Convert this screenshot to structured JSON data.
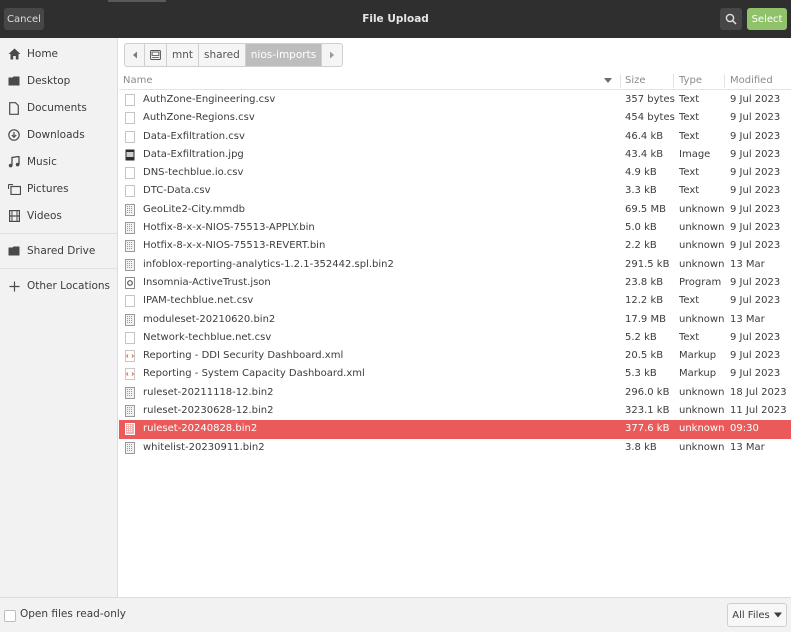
{
  "header": {
    "cancel_label": "Cancel",
    "title": "File Upload",
    "select_label": "Select"
  },
  "sidebar": {
    "items": [
      {
        "label": "Home",
        "icon": "home-icon"
      },
      {
        "label": "Desktop",
        "icon": "desktop-icon"
      },
      {
        "label": "Documents",
        "icon": "documents-icon"
      },
      {
        "label": "Downloads",
        "icon": "downloads-icon"
      },
      {
        "label": "Music",
        "icon": "music-icon"
      },
      {
        "label": "Pictures",
        "icon": "pictures-icon"
      },
      {
        "label": "Videos",
        "icon": "videos-icon"
      },
      {
        "label": "Shared Drive",
        "icon": "drive-icon"
      },
      {
        "label": "Other Locations",
        "icon": "plus-icon"
      }
    ]
  },
  "pathbar": {
    "segments": [
      "mnt",
      "shared",
      "nios-imports"
    ]
  },
  "columns": {
    "name": "Name",
    "size": "Size",
    "type": "Type",
    "modified": "Modified"
  },
  "files": [
    {
      "name": "AuthZone-Engineering.csv",
      "size": "357 bytes",
      "type": "Text",
      "modified": "9 Jul 2023",
      "icon": "text-file-icon"
    },
    {
      "name": "AuthZone-Regions.csv",
      "size": "454 bytes",
      "type": "Text",
      "modified": "9 Jul 2023",
      "icon": "text-file-icon"
    },
    {
      "name": "Data-Exfiltration.csv",
      "size": "46.4 kB",
      "type": "Text",
      "modified": "9 Jul 2023",
      "icon": "text-file-icon"
    },
    {
      "name": "Data-Exfiltration.jpg",
      "size": "43.4 kB",
      "type": "Image",
      "modified": "9 Jul 2023",
      "icon": "image-file-icon"
    },
    {
      "name": "DNS-techblue.io.csv",
      "size": "4.9 kB",
      "type": "Text",
      "modified": "9 Jul 2023",
      "icon": "text-file-icon"
    },
    {
      "name": "DTC-Data.csv",
      "size": "3.3 kB",
      "type": "Text",
      "modified": "9 Jul 2023",
      "icon": "text-file-icon"
    },
    {
      "name": "GeoLite2-City.mmdb",
      "size": "69.5 MB",
      "type": "unknown",
      "modified": "9 Jul 2023",
      "icon": "binary-file-icon"
    },
    {
      "name": "Hotfix-8-x-x-NIOS-75513-APPLY.bin",
      "size": "5.0 kB",
      "type": "unknown",
      "modified": "9 Jul 2023",
      "icon": "binary-file-icon"
    },
    {
      "name": "Hotfix-8-x-x-NIOS-75513-REVERT.bin",
      "size": "2.2 kB",
      "type": "unknown",
      "modified": "9 Jul 2023",
      "icon": "binary-file-icon"
    },
    {
      "name": "infoblox-reporting-analytics-1.2.1-352442.spl.bin2",
      "size": "291.5 kB",
      "type": "unknown",
      "modified": "13 Mar",
      "icon": "binary-file-icon"
    },
    {
      "name": "Insomnia-ActiveTrust.json",
      "size": "23.8 kB",
      "type": "Program",
      "modified": "9 Jul 2023",
      "icon": "program-file-icon"
    },
    {
      "name": "IPAM-techblue.net.csv",
      "size": "12.2 kB",
      "type": "Text",
      "modified": "9 Jul 2023",
      "icon": "text-file-icon"
    },
    {
      "name": "moduleset-20210620.bin2",
      "size": "17.9 MB",
      "type": "unknown",
      "modified": "13 Mar",
      "icon": "binary-file-icon"
    },
    {
      "name": "Network-techblue.net.csv",
      "size": "5.2 kB",
      "type": "Text",
      "modified": "9 Jul 2023",
      "icon": "text-file-icon"
    },
    {
      "name": "Reporting - DDI Security Dashboard.xml",
      "size": "20.5 kB",
      "type": "Markup",
      "modified": "9 Jul 2023",
      "icon": "markup-file-icon"
    },
    {
      "name": "Reporting - System Capacity Dashboard.xml",
      "size": "5.3 kB",
      "type": "Markup",
      "modified": "9 Jul 2023",
      "icon": "markup-file-icon"
    },
    {
      "name": "ruleset-20211118-12.bin2",
      "size": "296.0 kB",
      "type": "unknown",
      "modified": "18 Jul 2023",
      "icon": "binary-file-icon"
    },
    {
      "name": "ruleset-20230628-12.bin2",
      "size": "323.1 kB",
      "type": "unknown",
      "modified": "11 Jul 2023",
      "icon": "binary-file-icon"
    },
    {
      "name": "ruleset-20240828.bin2",
      "size": "377.6 kB",
      "type": "unknown",
      "modified": "09:30",
      "icon": "binary-file-icon",
      "selected": true
    },
    {
      "name": "whitelist-20230911.bin2",
      "size": "3.8 kB",
      "type": "unknown",
      "modified": "13 Mar",
      "icon": "binary-file-icon"
    }
  ],
  "bottom": {
    "readonly_label": "Open files read-only",
    "filter_label": "All Files"
  },
  "colors": {
    "header_bg": "#2f2f2f",
    "accent_green": "#8fc26a",
    "selection_red": "#eb5a5a"
  }
}
